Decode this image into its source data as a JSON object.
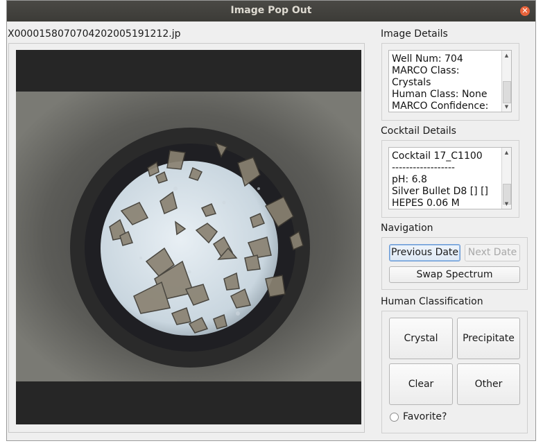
{
  "window": {
    "title": "Image Pop Out"
  },
  "image": {
    "filename": "X000015807070420200519121​2.jp"
  },
  "image_details": {
    "label": "Image Details",
    "text": "Well Num: 704\nMARCO Class:\nCrystals\nHuman Class: None\nMARCO Confidence:"
  },
  "cocktail_details": {
    "label": "Cocktail Details",
    "text": "Cocktail 17_C1100\n------------------\npH: 6.8\nSilver Bullet D8 [] []\nHEPES 0.06 M"
  },
  "navigation": {
    "label": "Navigation",
    "previous_date": "Previous Date",
    "next_date": "Next Date",
    "swap_spectrum": "Swap Spectrum"
  },
  "human_classification": {
    "label": "Human Classification",
    "crystal": "Crystal",
    "precipitate": "Precipitate",
    "clear": "Clear",
    "other": "Other",
    "favorite": "Favorite?"
  },
  "colors": {
    "titlebar": "#3c3b37",
    "close": "#e9633b",
    "focus": "#6b9bd6"
  }
}
